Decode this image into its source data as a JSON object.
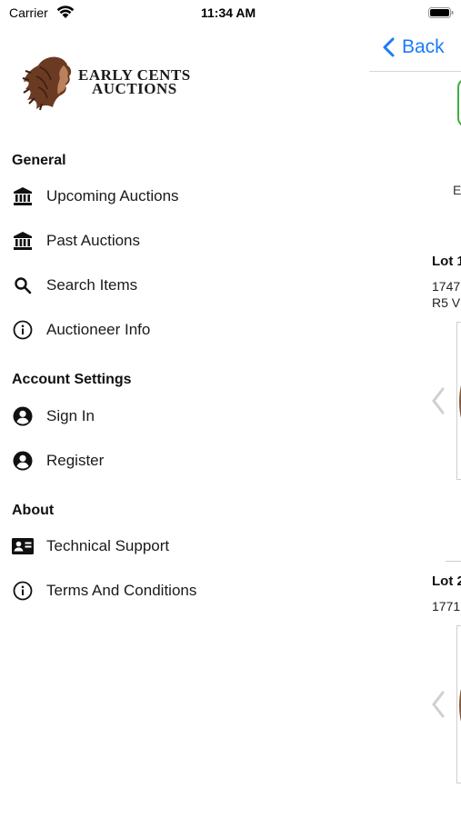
{
  "status_bar": {
    "carrier": "Carrier",
    "time": "11:34 AM"
  },
  "logo": {
    "line1": "EARLY CENTS",
    "line2": "AUCTIONS"
  },
  "background_page": {
    "back_label": "Back",
    "letter": "E",
    "lot1_title": "Lot 1",
    "lot1_line1": "1747",
    "lot1_line2": "R5 V",
    "lot2_title": "Lot 2",
    "lot2_line1": "1771"
  },
  "menu": {
    "sections": [
      {
        "title": "General",
        "items": [
          {
            "label": "Upcoming Auctions",
            "icon": "bank-icon"
          },
          {
            "label": "Past Auctions",
            "icon": "bank-icon"
          },
          {
            "label": "Search Items",
            "icon": "search-icon"
          },
          {
            "label": "Auctioneer Info",
            "icon": "info-icon"
          }
        ]
      },
      {
        "title": "Account Settings",
        "items": [
          {
            "label": "Sign In",
            "icon": "account-circle-icon"
          },
          {
            "label": "Register",
            "icon": "account-circle-icon"
          }
        ]
      },
      {
        "title": "About",
        "items": [
          {
            "label": "Technical Support",
            "icon": "contact-card-icon"
          },
          {
            "label": "Terms And Conditions",
            "icon": "info-icon"
          }
        ]
      }
    ]
  },
  "colors": {
    "accent_blue": "#1a7cf6",
    "green_outline": "#3fae3f",
    "coin_brown": "#8a5a3c"
  }
}
